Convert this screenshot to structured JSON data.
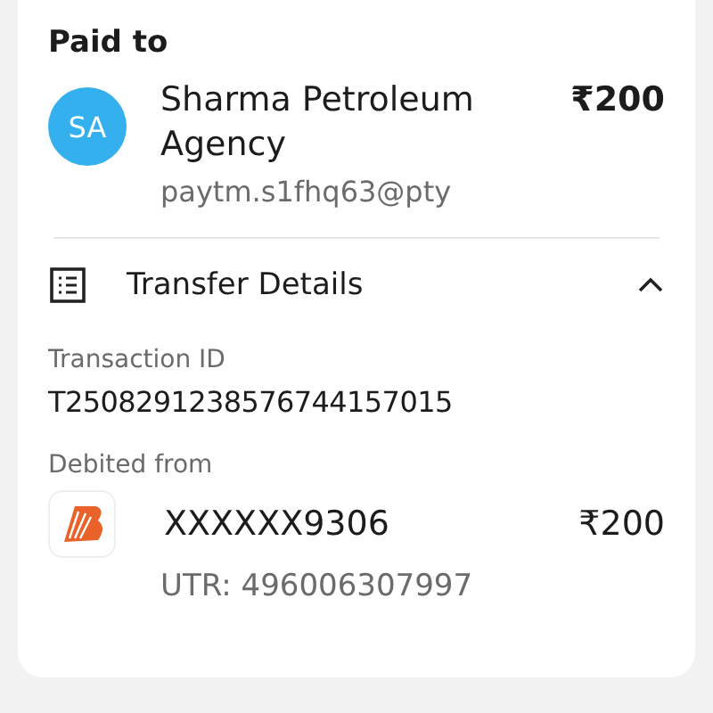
{
  "heading": "Paid to",
  "payee": {
    "initials": "SA",
    "color": "#35b0ee",
    "name": "Sharma Petroleum Agency",
    "amount": "₹200",
    "vpa": "paytm.s1fhq63@pty"
  },
  "transfer_details": {
    "title": "Transfer Details",
    "expanded": true,
    "fields": [
      {
        "label": "Transaction ID",
        "value": "T2508291238576744157015"
      }
    ],
    "debited_from": {
      "label": "Debited from",
      "account": "XXXXXX9306",
      "amount": "₹200",
      "utr": "UTR: 496006307997"
    }
  }
}
